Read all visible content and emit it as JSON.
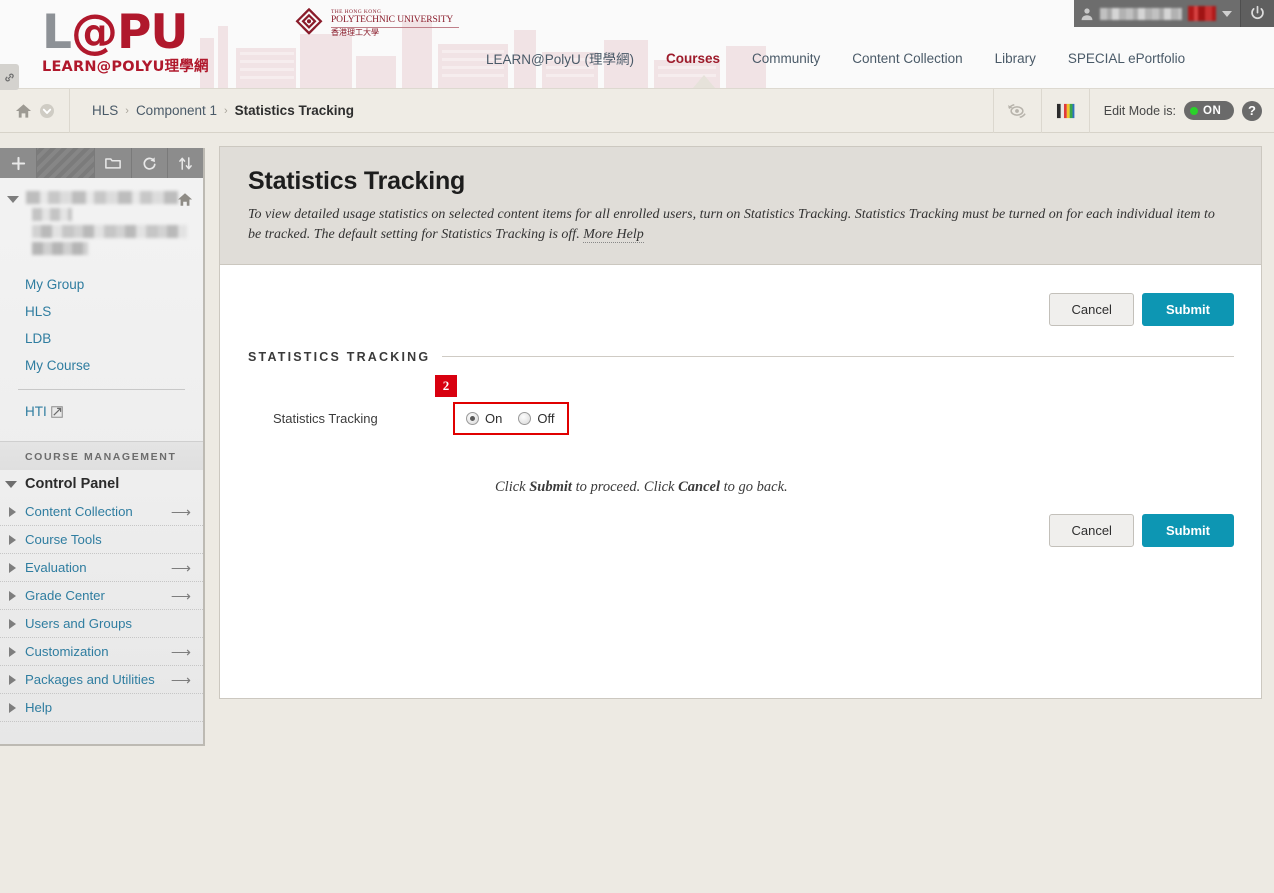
{
  "branding": {
    "logo_main_l": "L",
    "logo_main_at": "@",
    "logo_main_pu": "PU",
    "logo_sub": "LEARN@POLYU理學網",
    "university_line1": "THE HONG KONG",
    "university_line2": "POLYTECHNIC UNIVERSITY",
    "university_line3": "香港理工大學"
  },
  "user_strip": {
    "avatar_icon": "user-icon",
    "username": "",
    "notification_badge": "",
    "dropdown_icon": "chevron-down-icon",
    "logout_icon": "power-icon"
  },
  "main_nav": {
    "items": [
      {
        "label": "LEARN@PolyU (理學網)",
        "active": false
      },
      {
        "label": "Courses",
        "active": true
      },
      {
        "label": "Community",
        "active": false
      },
      {
        "label": "Content Collection",
        "active": false
      },
      {
        "label": "Library",
        "active": false
      },
      {
        "label": "SPECIAL ePortfolio",
        "active": false
      }
    ]
  },
  "breadcrumb": {
    "home_icon": "home-icon",
    "dropdown_icon": "chevron-down-circle-icon",
    "items": [
      "HLS",
      "Component 1",
      "Statistics Tracking"
    ],
    "separator": "›",
    "current": "Statistics Tracking",
    "refresh_icon": "refresh-preview-icon",
    "theme_icon": "color-palette-icon",
    "edit_mode_label": "Edit Mode is:",
    "edit_mode_state": "ON",
    "help_label": "?"
  },
  "sidebar": {
    "toolbar": {
      "add_icon": "plus-icon",
      "folder_icon": "folder-icon",
      "refresh_icon": "refresh-icon",
      "sort_icon": "sort-updown-icon"
    },
    "course_home_icon": "home-icon",
    "collapse_icon": "triangle-down-icon",
    "course_name": "",
    "links": [
      "My Group",
      "HLS",
      "LDB",
      "My Course"
    ],
    "external_link": {
      "label": "HTI",
      "icon": "external-link-icon"
    },
    "course_management_header": "COURSE MANAGEMENT",
    "control_panel_label": "Control Panel",
    "control_panel_items": [
      {
        "label": "Content Collection",
        "has_goto": true
      },
      {
        "label": "Course Tools",
        "has_goto": false
      },
      {
        "label": "Evaluation",
        "has_goto": true
      },
      {
        "label": "Grade Center",
        "has_goto": true
      },
      {
        "label": "Users and Groups",
        "has_goto": false
      },
      {
        "label": "Customization",
        "has_goto": true
      },
      {
        "label": "Packages and Utilities",
        "has_goto": true
      },
      {
        "label": "Help",
        "has_goto": false
      }
    ],
    "goto_arrow": "⟶"
  },
  "page": {
    "title": "Statistics Tracking",
    "description": "To view detailed usage statistics on selected content items for all enrolled users, turn on Statistics Tracking. Statistics Tracking must be turned on for each individual item to be tracked. The default setting for Statistics Tracking is off.",
    "more_help": "More Help",
    "section_label": "STATISTICS TRACKING",
    "field_label": "Statistics Tracking",
    "radio_options": [
      {
        "label": "On",
        "selected": true
      },
      {
        "label": "Off",
        "selected": false
      }
    ],
    "annotation_badge": "2",
    "hint_prefix": "Click ",
    "hint_submit": "Submit",
    "hint_middle": " to proceed. Click ",
    "hint_cancel": "Cancel",
    "hint_suffix": " to go back.",
    "cancel_label": "Cancel",
    "submit_label": "Submit"
  },
  "colors": {
    "brand_red": "#b0182c",
    "submit_teal": "#0d96b3",
    "link_blue": "#2f7da0",
    "annotation_red": "#d8000f",
    "edit_mode_green": "#2ad12a"
  }
}
